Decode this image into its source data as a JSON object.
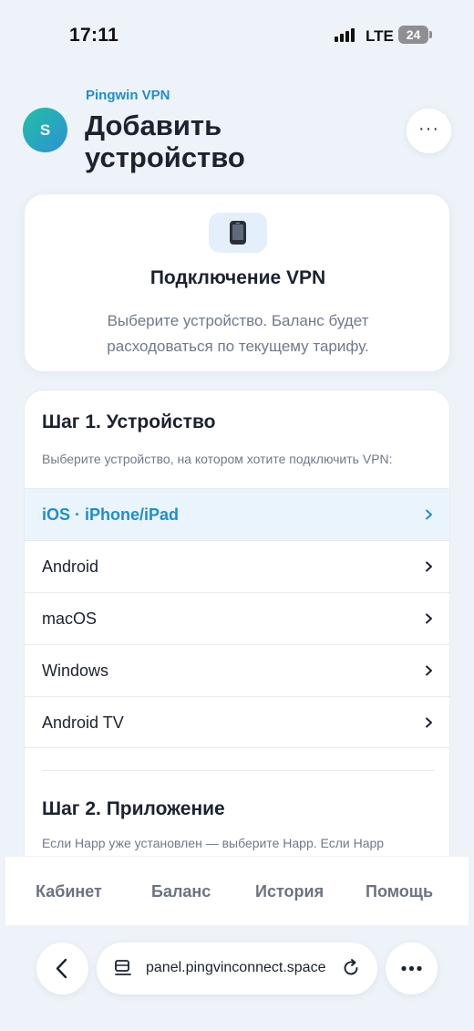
{
  "status_bar": {
    "time": "17:11",
    "network": "LTE",
    "battery": "24"
  },
  "header": {
    "avatar_initial": "S",
    "app_name": "Pingwin VPN",
    "title": "Добавить устройство",
    "more_label": "···"
  },
  "hero": {
    "icon": "mobile-phone-icon",
    "title": "Подключение VPN",
    "description": "Выберите устройство. Баланс будет расходоваться по текущему тарифу."
  },
  "step1": {
    "title": "Шаг 1. Устройство",
    "description": "Выберите устройство, на котором хотите подключить VPN:",
    "devices": [
      {
        "label": "iOS · iPhone/iPad",
        "selected": true
      },
      {
        "label": "Android",
        "selected": false
      },
      {
        "label": "macOS",
        "selected": false
      },
      {
        "label": "Windows",
        "selected": false
      },
      {
        "label": "Android TV",
        "selected": false
      }
    ]
  },
  "step2": {
    "title": "Шаг 2. Приложение",
    "description": "Если Happ уже установлен — выберите Happ. Если Happ"
  },
  "tabs": [
    {
      "label": "Кабинет"
    },
    {
      "label": "Баланс"
    },
    {
      "label": "История"
    },
    {
      "label": "Помощь"
    }
  ],
  "browser": {
    "url": "panel.pingvinconnect.space"
  },
  "colors": {
    "accent": "#1f8ecb",
    "selected_row_bg": "#eaf4fc",
    "page_bg": "#eef3f9"
  }
}
